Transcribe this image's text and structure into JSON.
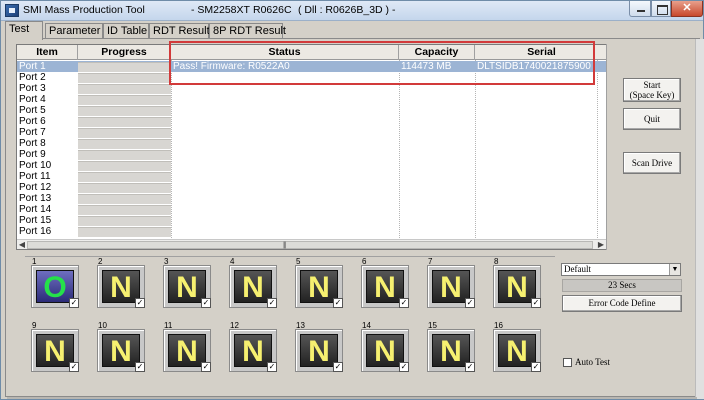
{
  "window": {
    "app_name": "SMI Mass Production Tool",
    "controller": "- SM2258XT",
    "fw": "R0626C",
    "dll": "( Dll : R0626B_3D )  -"
  },
  "tabs": [
    "Test",
    "Parameter",
    "ID Table",
    "RDT Result",
    "8P RDT Result"
  ],
  "table": {
    "headers": [
      "Item",
      "Progress",
      "Status",
      "Capacity",
      "Serial"
    ],
    "rows": [
      {
        "item": "Port 1",
        "status": "Pass! Firmware: R0522A0",
        "capacity": "114473 MB",
        "serial": "DLTSIDB1740021875900"
      },
      {
        "item": "Port 2",
        "status": "",
        "capacity": "",
        "serial": ""
      },
      {
        "item": "Port 3",
        "status": "",
        "capacity": "",
        "serial": ""
      },
      {
        "item": "Port 4",
        "status": "",
        "capacity": "",
        "serial": ""
      },
      {
        "item": "Port 5",
        "status": "",
        "capacity": "",
        "serial": ""
      },
      {
        "item": "Port 6",
        "status": "",
        "capacity": "",
        "serial": ""
      },
      {
        "item": "Port 7",
        "status": "",
        "capacity": "",
        "serial": ""
      },
      {
        "item": "Port 8",
        "status": "",
        "capacity": "",
        "serial": ""
      },
      {
        "item": "Port 9",
        "status": "",
        "capacity": "",
        "serial": ""
      },
      {
        "item": "Port 10",
        "status": "",
        "capacity": "",
        "serial": ""
      },
      {
        "item": "Port 11",
        "status": "",
        "capacity": "",
        "serial": ""
      },
      {
        "item": "Port 12",
        "status": "",
        "capacity": "",
        "serial": ""
      },
      {
        "item": "Port 13",
        "status": "",
        "capacity": "",
        "serial": ""
      },
      {
        "item": "Port 14",
        "status": "",
        "capacity": "",
        "serial": ""
      },
      {
        "item": "Port 15",
        "status": "",
        "capacity": "",
        "serial": ""
      },
      {
        "item": "Port 16",
        "status": "",
        "capacity": "",
        "serial": ""
      }
    ],
    "selected_row": "Port 1",
    "highlight_color": "#d23a3a"
  },
  "buttons": {
    "start_line1": "Start",
    "start_line2": "(Space Key)",
    "quit": "Quit",
    "scan": "Scan Drive",
    "error_code": "Error Code Define"
  },
  "ports": [
    {
      "num": "1",
      "state": "O",
      "checked": true
    },
    {
      "num": "2",
      "state": "N",
      "checked": true
    },
    {
      "num": "3",
      "state": "N",
      "checked": true
    },
    {
      "num": "4",
      "state": "N",
      "checked": true
    },
    {
      "num": "5",
      "state": "N",
      "checked": true
    },
    {
      "num": "6",
      "state": "N",
      "checked": true
    },
    {
      "num": "7",
      "state": "N",
      "checked": true
    },
    {
      "num": "8",
      "state": "N",
      "checked": true
    },
    {
      "num": "9",
      "state": "N",
      "checked": true
    },
    {
      "num": "10",
      "state": "N",
      "checked": true
    },
    {
      "num": "11",
      "state": "N",
      "checked": true
    },
    {
      "num": "12",
      "state": "N",
      "checked": true
    },
    {
      "num": "13",
      "state": "N",
      "checked": true
    },
    {
      "num": "14",
      "state": "N",
      "checked": true
    },
    {
      "num": "15",
      "state": "N",
      "checked": true
    },
    {
      "num": "16",
      "state": "N",
      "checked": true
    }
  ],
  "settings": {
    "profile": "Default",
    "elapsed": "23 Secs",
    "auto_test_label": "Auto Test",
    "auto_test_checked": false
  }
}
